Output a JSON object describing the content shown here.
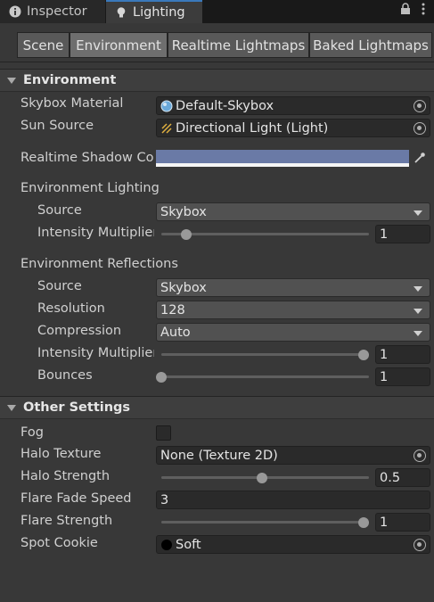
{
  "tabs": [
    {
      "label": "Inspector",
      "icon": "info-icon",
      "active": false
    },
    {
      "label": "Lighting",
      "icon": "lightbulb-icon",
      "active": true
    }
  ],
  "window_controls": {
    "lock": "lock-icon",
    "menu": "kebab-menu-icon"
  },
  "toolbar": {
    "buttons": [
      {
        "label": "Scene",
        "active": false
      },
      {
        "label": "Environment",
        "active": true
      },
      {
        "label": "Realtime Lightmaps",
        "active": false
      },
      {
        "label": "Baked Lightmaps",
        "active": false
      }
    ]
  },
  "environment": {
    "header": "Environment",
    "skybox_material": {
      "label": "Skybox Material",
      "value": "Default-Skybox"
    },
    "sun_source": {
      "label": "Sun Source",
      "value": "Directional Light (Light)"
    },
    "realtime_shadow_color": {
      "label": "Realtime Shadow Co",
      "color": "#6a7aa6"
    },
    "env_lighting": {
      "label": "Environment Lighting",
      "source": {
        "label": "Source",
        "value": "Skybox"
      },
      "intensity": {
        "label": "Intensity Multiplier",
        "value": "1",
        "fraction": 0.125
      }
    },
    "env_reflections": {
      "label": "Environment Reflections",
      "source": {
        "label": "Source",
        "value": "Skybox"
      },
      "resolution": {
        "label": "Resolution",
        "value": "128"
      },
      "compression": {
        "label": "Compression",
        "value": "Auto"
      },
      "intensity": {
        "label": "Intensity Multiplier",
        "value": "1",
        "fraction": 1.0
      },
      "bounces": {
        "label": "Bounces",
        "value": "1",
        "fraction": 0.0
      }
    }
  },
  "other_settings": {
    "header": "Other Settings",
    "fog": {
      "label": "Fog",
      "checked": false
    },
    "halo_texture": {
      "label": "Halo Texture",
      "value": "None (Texture 2D)"
    },
    "halo_strength": {
      "label": "Halo Strength",
      "value": "0.5",
      "fraction": 0.5
    },
    "flare_fade_speed": {
      "label": "Flare Fade Speed",
      "value": "3"
    },
    "flare_strength": {
      "label": "Flare Strength",
      "value": "1",
      "fraction": 1.0
    },
    "spot_cookie": {
      "label": "Spot Cookie",
      "value": "Soft"
    }
  },
  "colors": {
    "accent": "#3a79bb",
    "shadow_color": "#6a7aa6"
  }
}
